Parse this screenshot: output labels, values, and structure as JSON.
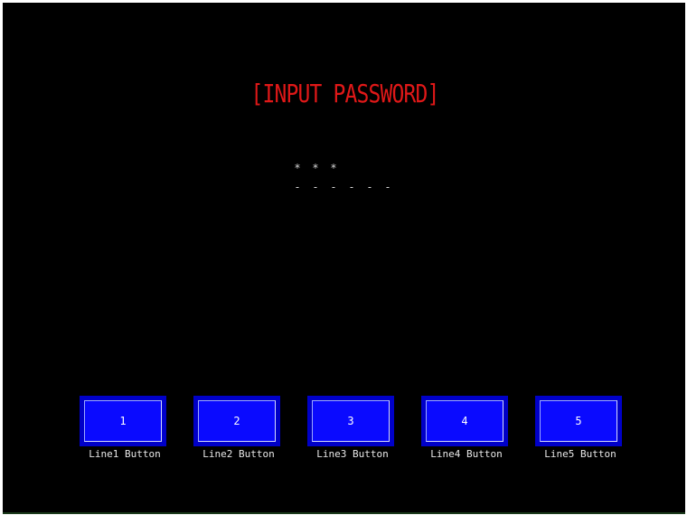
{
  "screen": {
    "title": "[INPUT PASSWORD]",
    "password": {
      "masked": [
        "*",
        "*",
        "*",
        "",
        "",
        ""
      ],
      "slots": [
        "-",
        "-",
        "-",
        "-",
        "-",
        "-"
      ]
    },
    "buttons": [
      {
        "label": "1",
        "caption": "Line1 Button"
      },
      {
        "label": "2",
        "caption": "Line2 Button"
      },
      {
        "label": "3",
        "caption": "Line3 Button"
      },
      {
        "label": "4",
        "caption": "Line4 Button"
      },
      {
        "label": "5",
        "caption": "Line5 Button"
      }
    ]
  },
  "colors": {
    "background": "#000000",
    "title": "#e01818",
    "button": "#0a0aff"
  }
}
